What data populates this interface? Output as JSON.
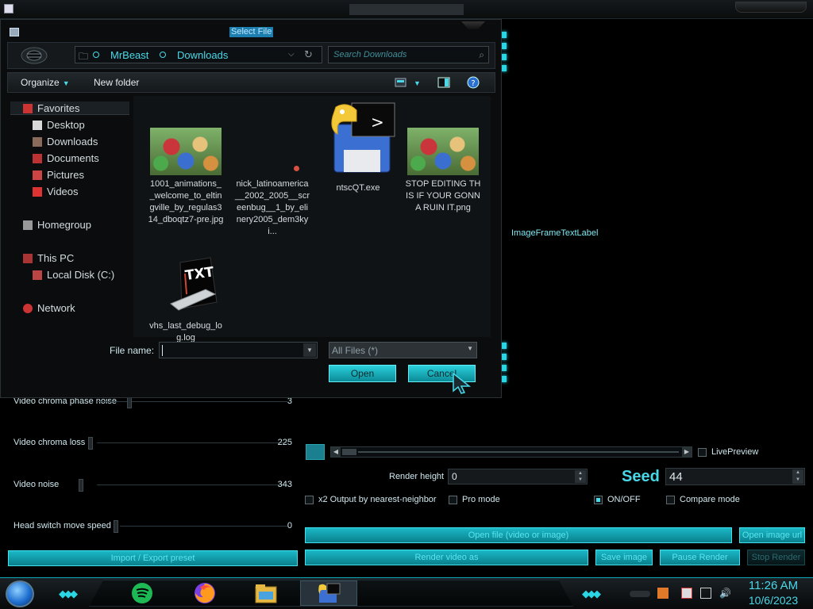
{
  "app": {
    "image_label": "ImageFrameTextLabel",
    "sliders": [
      {
        "label": "Video chroma phase noise",
        "value": "3"
      },
      {
        "label": "Video chroma loss",
        "value": "225"
      },
      {
        "label": "Video noise",
        "value": "343"
      },
      {
        "label": "Head switch move speed",
        "value": "0"
      }
    ],
    "live_preview": "LivePreview",
    "render_height_label": "Render height",
    "render_height_value": "0",
    "seed_label": "Seed",
    "seed_value": "44",
    "checkboxes": {
      "x2_output": "x2 Output by nearest-neighbor",
      "pro_mode": "Pro mode",
      "on_off": "ON/OFF",
      "compare_mode": "Compare mode"
    },
    "buttons": {
      "open_file": "Open file (video or image)",
      "open_image_url": "Open image url",
      "import_export": "Import / Export preset",
      "render_video": "Render video as",
      "save_image": "Save image",
      "pause_render": "Pause Render",
      "stop_render": "Stop Render"
    },
    "accent_color": "#48d8e8"
  },
  "dialog": {
    "title": "Select File",
    "breadcrumbs": [
      "MrBeast",
      "Downloads"
    ],
    "search_placeholder": "Search Downloads",
    "toolbar": {
      "organize": "Organize",
      "new_folder": "New folder"
    },
    "nav": {
      "favorites": "Favorites",
      "desktop": "Desktop",
      "downloads": "Downloads",
      "documents": "Documents",
      "pictures": "Pictures",
      "videos": "Videos",
      "homegroup": "Homegroup",
      "this_pc": "This PC",
      "local_disk": "Local Disk (C:)",
      "network": "Network"
    },
    "files": [
      {
        "name": "1001_animations__welcome_to_eltingville_by_regulas314_dboqtz7-pre.jpg",
        "icon": "image-thumbnail"
      },
      {
        "name": "nick_latinoamerica__2002_2005__screenbug__1_by_elinery2005_dem3kyi...",
        "icon": "image-thumbnail"
      },
      {
        "name": "ntscQT.exe",
        "icon": "python-exe-icon"
      },
      {
        "name": "STOP EDITING THIS IF YOUR GONNA RUIN IT.png",
        "icon": "image-thumbnail"
      },
      {
        "name": "vhs_last_debug_log.log",
        "icon": "txt-file-icon"
      }
    ],
    "file_name_label": "File name:",
    "file_name_value": "",
    "filter_value": "All Files (*)",
    "open_label": "Open",
    "cancel_label": "Cancel"
  },
  "taskbar": {
    "apps": [
      "spotify",
      "firefox",
      "file-explorer",
      "ntscqt"
    ],
    "time": "11:26 AM",
    "date": "10/6/2023"
  }
}
